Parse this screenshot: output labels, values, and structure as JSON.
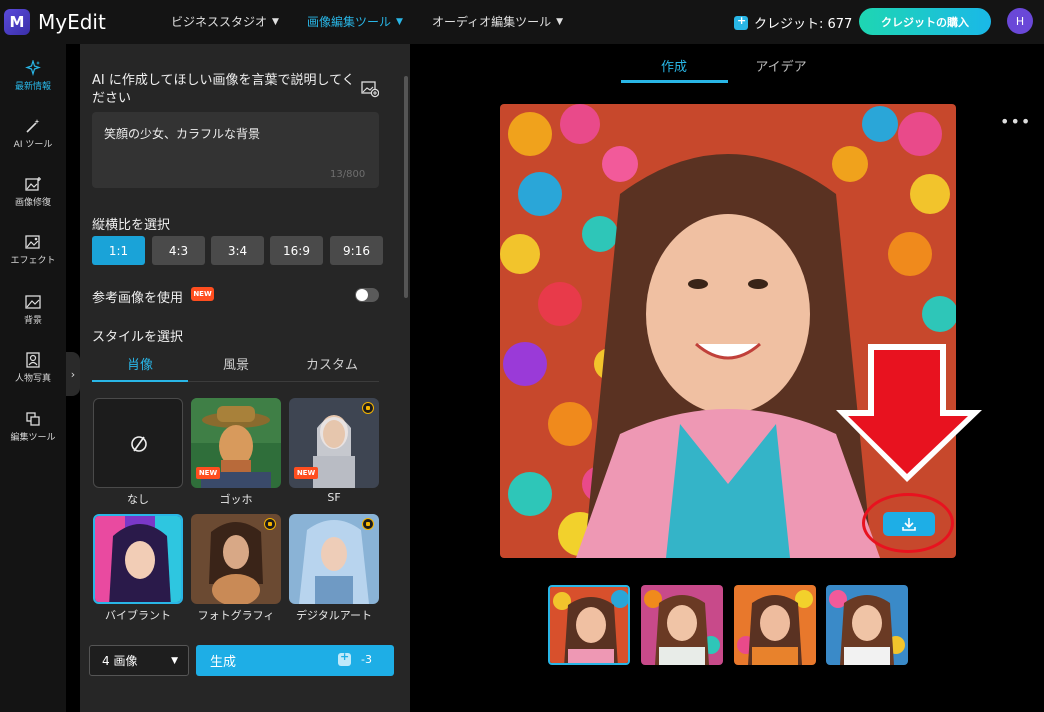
{
  "app": {
    "logo_text": "MyEdit",
    "logo_letter": "M"
  },
  "header": {
    "nav": [
      {
        "label": "ビジネススタジオ",
        "active": false
      },
      {
        "label": "画像編集ツール",
        "active": true
      },
      {
        "label": "オーディオ編集ツール",
        "active": false
      }
    ],
    "credit_text": "クレジット: 677",
    "buy_button": "クレジットの購入",
    "avatar_letter": "H"
  },
  "rail": {
    "items": [
      {
        "label": "最新情報",
        "icon": "sparkle-icon",
        "active": true
      },
      {
        "label": "AI ツール",
        "icon": "magic-wand-icon",
        "active": false
      },
      {
        "label": "画像修復",
        "icon": "image-plus-icon",
        "active": false
      },
      {
        "label": "エフェクト",
        "icon": "image-effect-icon",
        "active": false
      },
      {
        "label": "背景",
        "icon": "background-icon",
        "active": false
      },
      {
        "label": "人物写真",
        "icon": "portrait-icon",
        "active": false
      },
      {
        "label": "編集ツール",
        "icon": "edit-tools-icon",
        "active": false
      }
    ],
    "toggle_glyph": "›"
  },
  "panel": {
    "prompt_label": "AI に作成してほしい画像を言葉で説明してください",
    "prompt_value": "笑顔の少女、カラフルな背景",
    "prompt_count": "13/800",
    "ratio_label": "縦横比を選択",
    "ratios": [
      "1:1",
      "4:3",
      "3:4",
      "16:9",
      "9:16"
    ],
    "ratio_selected": "1:1",
    "reference_label": "参考画像を使用",
    "new_badge": "NEW",
    "reference_enabled": false,
    "style_label": "スタイルを選択",
    "style_tabs": [
      "肖像",
      "風景",
      "カスタム"
    ],
    "style_tab_active": "肖像",
    "styles": [
      {
        "label": "なし"
      },
      {
        "label": "ゴッホ",
        "badge": "NEW"
      },
      {
        "label": "SF",
        "badge": "NEW"
      },
      {
        "label": "バイブラント"
      },
      {
        "label": "フォトグラフィ"
      },
      {
        "label": "デジタルアート"
      }
    ],
    "count_select": "4 画像",
    "generate_label": "生成",
    "generate_cost": "-3"
  },
  "main": {
    "tabs": [
      "作成",
      "アイデア"
    ],
    "tab_active": "作成",
    "more_glyph": "•••"
  }
}
